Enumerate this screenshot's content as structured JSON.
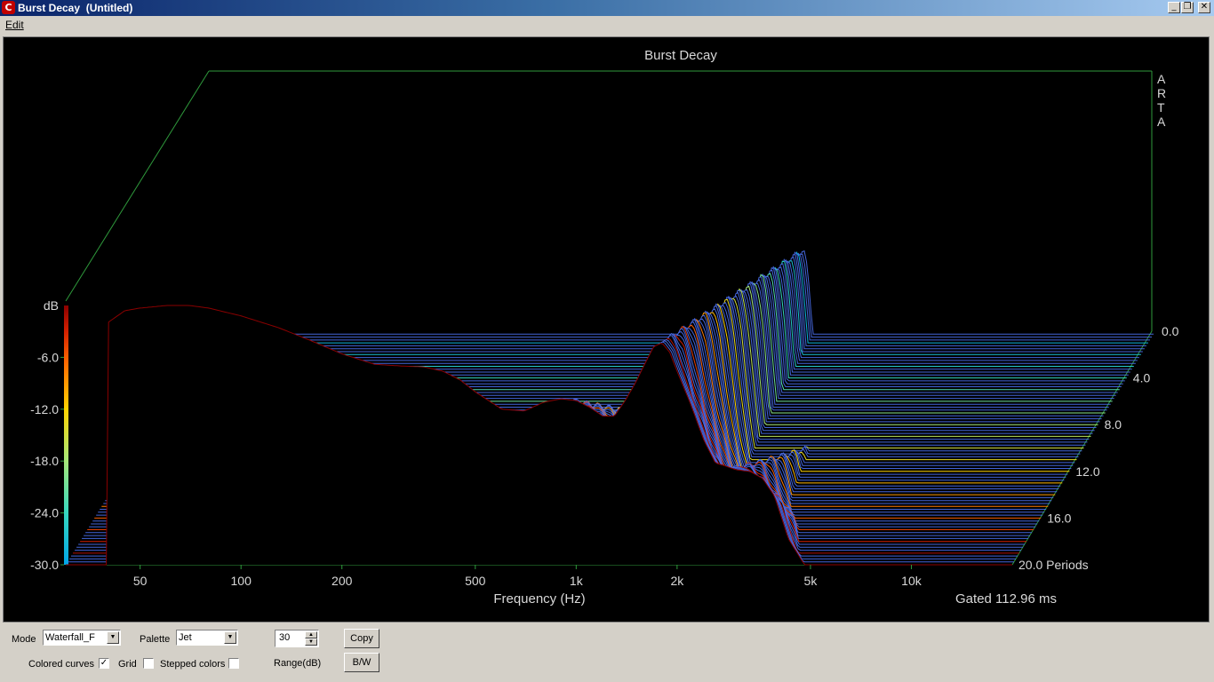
{
  "window": {
    "title": "Burst Decay  (Untitled)",
    "app_icon": "arta-app-icon",
    "minimize_icon": "minimize-icon",
    "maximize_icon": "restore-icon",
    "close_icon": "close-icon"
  },
  "menu": {
    "items": [
      {
        "label": "Edit"
      }
    ]
  },
  "plot": {
    "title": "Burst Decay",
    "brand_letters": [
      "A",
      "R",
      "T",
      "A"
    ],
    "colorbar": {
      "label": "dB",
      "ticks": [
        "-6.0",
        "-12.0",
        "-18.0",
        "-24.0",
        "-30.0"
      ],
      "palette": [
        "#8b0000",
        "#d42000",
        "#ff6a00",
        "#ffd400",
        "#a6e87a",
        "#36d8c0",
        "#00a6e8"
      ]
    },
    "x_axis": {
      "label": "Frequency (Hz)",
      "tick_labels": [
        "50",
        "100",
        "200",
        "500",
        "1k",
        "2k",
        "5k",
        "10k"
      ]
    },
    "z_axis": {
      "tick_labels": [
        "0.0",
        "4.0",
        "8.0",
        "12.0",
        "16.0",
        "20.0 Periods"
      ]
    },
    "gated_text": "Gated 112.96 ms",
    "colors": {
      "background": "#000000",
      "frame": "#2f9a3c",
      "baseline": "#4a6ff0"
    }
  },
  "chart_data": {
    "type": "waterfall",
    "title": "Burst Decay",
    "xlabel": "Frequency (Hz)",
    "zlabel": "Periods",
    "x_scale": "log",
    "xlim": [
      30,
      20000
    ],
    "zlim": [
      0,
      20
    ],
    "color_range_db": [
      -30,
      0
    ],
    "slice_count": 20,
    "first_slice_profile": {
      "freq_hz": [
        40,
        45,
        50,
        60,
        70,
        80,
        100,
        130,
        160,
        200,
        250,
        300,
        350,
        400,
        450,
        500,
        600,
        700,
        800,
        900,
        1000,
        1100,
        1200,
        1300,
        1400,
        1500,
        1600,
        1700,
        1800,
        1900,
        2000,
        2200,
        2400,
        2600,
        2800,
        3000,
        3300,
        3600,
        3900,
        4300,
        4800
      ],
      "level_db": [
        -2,
        -0.6,
        -0.3,
        0,
        0,
        -0.3,
        -1.2,
        -2.6,
        -4,
        -5.6,
        -6.8,
        -7,
        -7.1,
        -7.6,
        -8.6,
        -10,
        -12,
        -12.2,
        -11.2,
        -10.8,
        -11,
        -11.8,
        -12.8,
        -12.8,
        -11,
        -9,
        -6.8,
        -4.8,
        -4.3,
        -5.4,
        -7.6,
        -11.5,
        -15.5,
        -18.2,
        -18.6,
        -19,
        -19.2,
        -20,
        -22,
        -27,
        -30
      ]
    }
  },
  "controls": {
    "mode_label": "Mode",
    "mode_value": "Waterfall_F",
    "palette_label": "Palette",
    "palette_value": "Jet",
    "range_value": "30",
    "range_label": "Range(dB)",
    "copy_label": "Copy",
    "bw_label": "B/W",
    "colored_curves_label": "Colored curves",
    "colored_curves_checked": true,
    "grid_label": "Grid",
    "grid_checked": false,
    "stepped_colors_label": "Stepped colors",
    "stepped_colors_checked": false
  }
}
